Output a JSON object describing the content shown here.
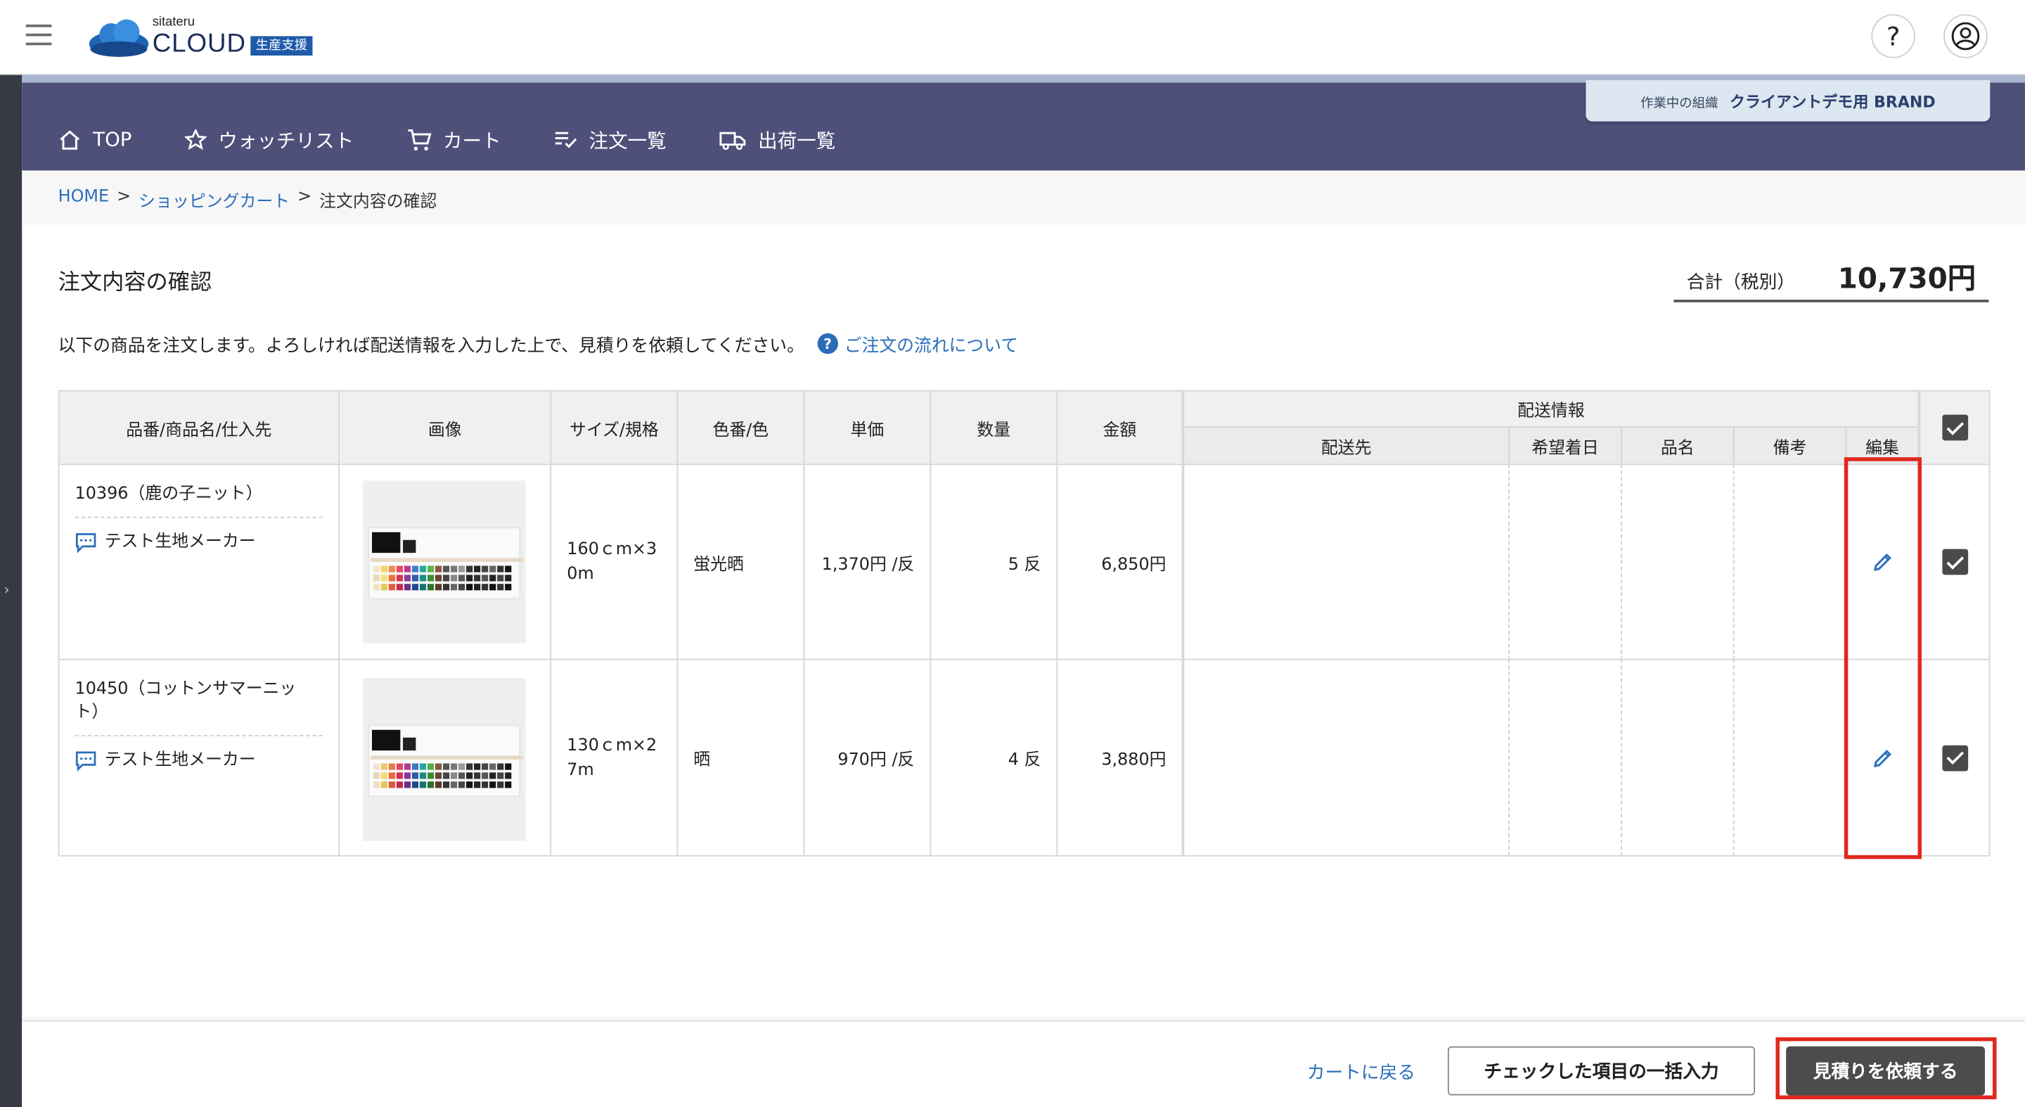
{
  "header": {
    "logo_sub": "sitateru",
    "logo_main": "CLOUD",
    "logo_badge": "生産支援",
    "help_glyph": "?"
  },
  "nav": {
    "items": [
      {
        "label": "TOP",
        "icon": "home-icon"
      },
      {
        "label": "ウォッチリスト",
        "icon": "star-icon"
      },
      {
        "label": "カート",
        "icon": "cart-icon"
      },
      {
        "label": "注文一覧",
        "icon": "list-check-icon"
      },
      {
        "label": "出荷一覧",
        "icon": "truck-icon"
      }
    ],
    "org_label": "作業中の組織",
    "org_value": "クライアントデモ用 BRAND"
  },
  "breadcrumb": {
    "home": "HOME",
    "sep": ">",
    "cart": "ショッピングカート",
    "current": "注文内容の確認"
  },
  "page": {
    "title": "注文内容の確認",
    "total_label": "合計（税別）",
    "total_value": "10,730円",
    "description": "以下の商品を注文します。よろしければ配送情報を入力した上で、見積りを依頼してください。",
    "help_link": "ご注文の流れについて"
  },
  "table": {
    "headers": {
      "name": "品番/商品名/仕入先",
      "image": "画像",
      "size": "サイズ/規格",
      "color": "色番/色",
      "unit_price": "単価",
      "quantity": "数量",
      "amount": "金額",
      "shipping": "配送情報",
      "destination": "配送先",
      "date": "希望着日",
      "item_name": "品名",
      "note": "備考",
      "edit": "編集"
    },
    "rows": [
      {
        "name": "10396（鹿の子ニット）",
        "maker": "テスト生地メーカー",
        "size": "160ｃm×30m",
        "color": "蛍光晒",
        "unit_price": "1,370円 /反",
        "quantity": "5 反",
        "amount": "6,850円",
        "checked": true
      },
      {
        "name": "10450（コットンサマーニット）",
        "maker": "テスト生地メーカー",
        "size": "130ｃm×27m",
        "color": "晒",
        "unit_price": "970円 /反",
        "quantity": "4 反",
        "amount": "3,880円",
        "checked": true
      }
    ]
  },
  "footer": {
    "back": "カートに戻る",
    "bulk": "チェックした項目の一括入力",
    "request": "見積りを依頼する"
  },
  "colors": {
    "nav_bg": "#4f507a",
    "link": "#2a6ebb",
    "highlight": "#e0281e",
    "primary_button": "#4c4c4c"
  }
}
